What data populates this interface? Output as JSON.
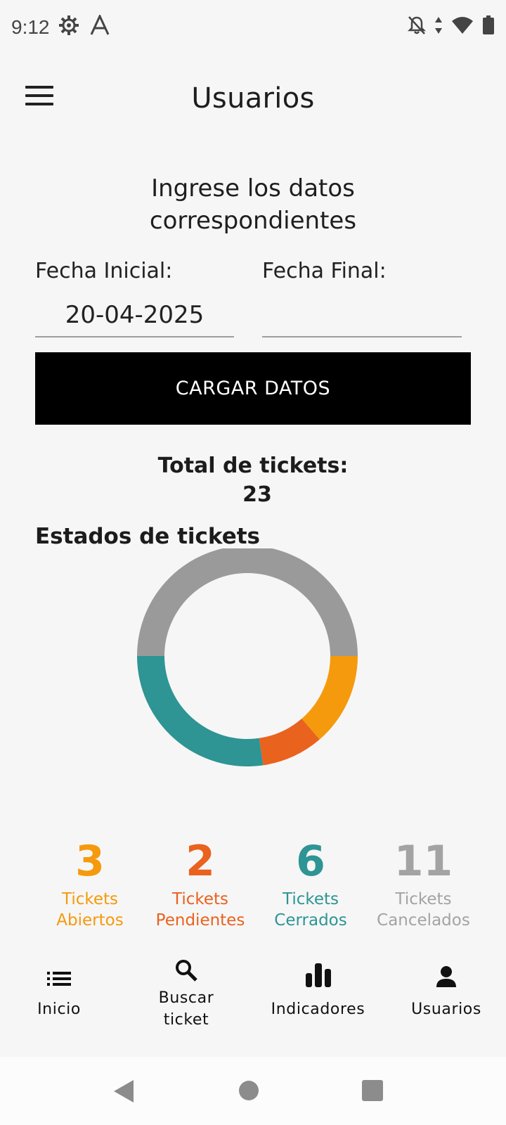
{
  "status_bar": {
    "time": "9:12",
    "left_icons": [
      "settings-gear-icon",
      "font-a-icon"
    ],
    "right_icons": [
      "notifications-off-icon",
      "data-arrows-icon",
      "wifi-icon",
      "battery-icon"
    ]
  },
  "app_bar": {
    "title": "Usuarios",
    "menu_icon": "hamburger-menu-icon"
  },
  "form": {
    "heading_line1": "Ingrese los datos",
    "heading_line2": "correspondientes",
    "start_date_label": "Fecha Inicial:",
    "start_date_value": "20-04-2025",
    "end_date_label": "Fecha Final:",
    "end_date_value": "",
    "load_button_label": "CARGAR DATOS"
  },
  "summary": {
    "total_label": "Total de tickets:",
    "total_value": "23"
  },
  "chart_data": {
    "type": "pie",
    "title": "Estados de tickets",
    "donut": true,
    "categories": [
      "Tickets Abiertos",
      "Tickets Pendientes",
      "Tickets Cerrados",
      "Tickets Cancelados"
    ],
    "values": [
      3,
      2,
      6,
      11
    ],
    "colors": [
      "#f59a0c",
      "#e9621e",
      "#2e9494",
      "#9a9a9a"
    ]
  },
  "stats": [
    {
      "value": "3",
      "line1": "Tickets",
      "line2": "Abiertos",
      "color": "#f59a0c"
    },
    {
      "value": "2",
      "line1": "Tickets",
      "line2": "Pendientes",
      "color": "#e9621e"
    },
    {
      "value": "6",
      "line1": "Tickets",
      "line2": "Cerrados",
      "color": "#2e9494"
    },
    {
      "value": "11",
      "line1": "Tickets",
      "line2": "Cancelados",
      "color": "#a3a3a3"
    }
  ],
  "bottom_nav": [
    {
      "label": "Inicio",
      "icon": "list-icon"
    },
    {
      "label": "Buscar",
      "label2": "ticket",
      "icon": "search-icon"
    },
    {
      "label": "Indicadores",
      "icon": "bar-chart-icon"
    },
    {
      "label": "Usuarios",
      "icon": "person-icon"
    }
  ],
  "system_nav": {
    "icons": [
      "back-icon",
      "home-icon",
      "recents-icon"
    ]
  }
}
